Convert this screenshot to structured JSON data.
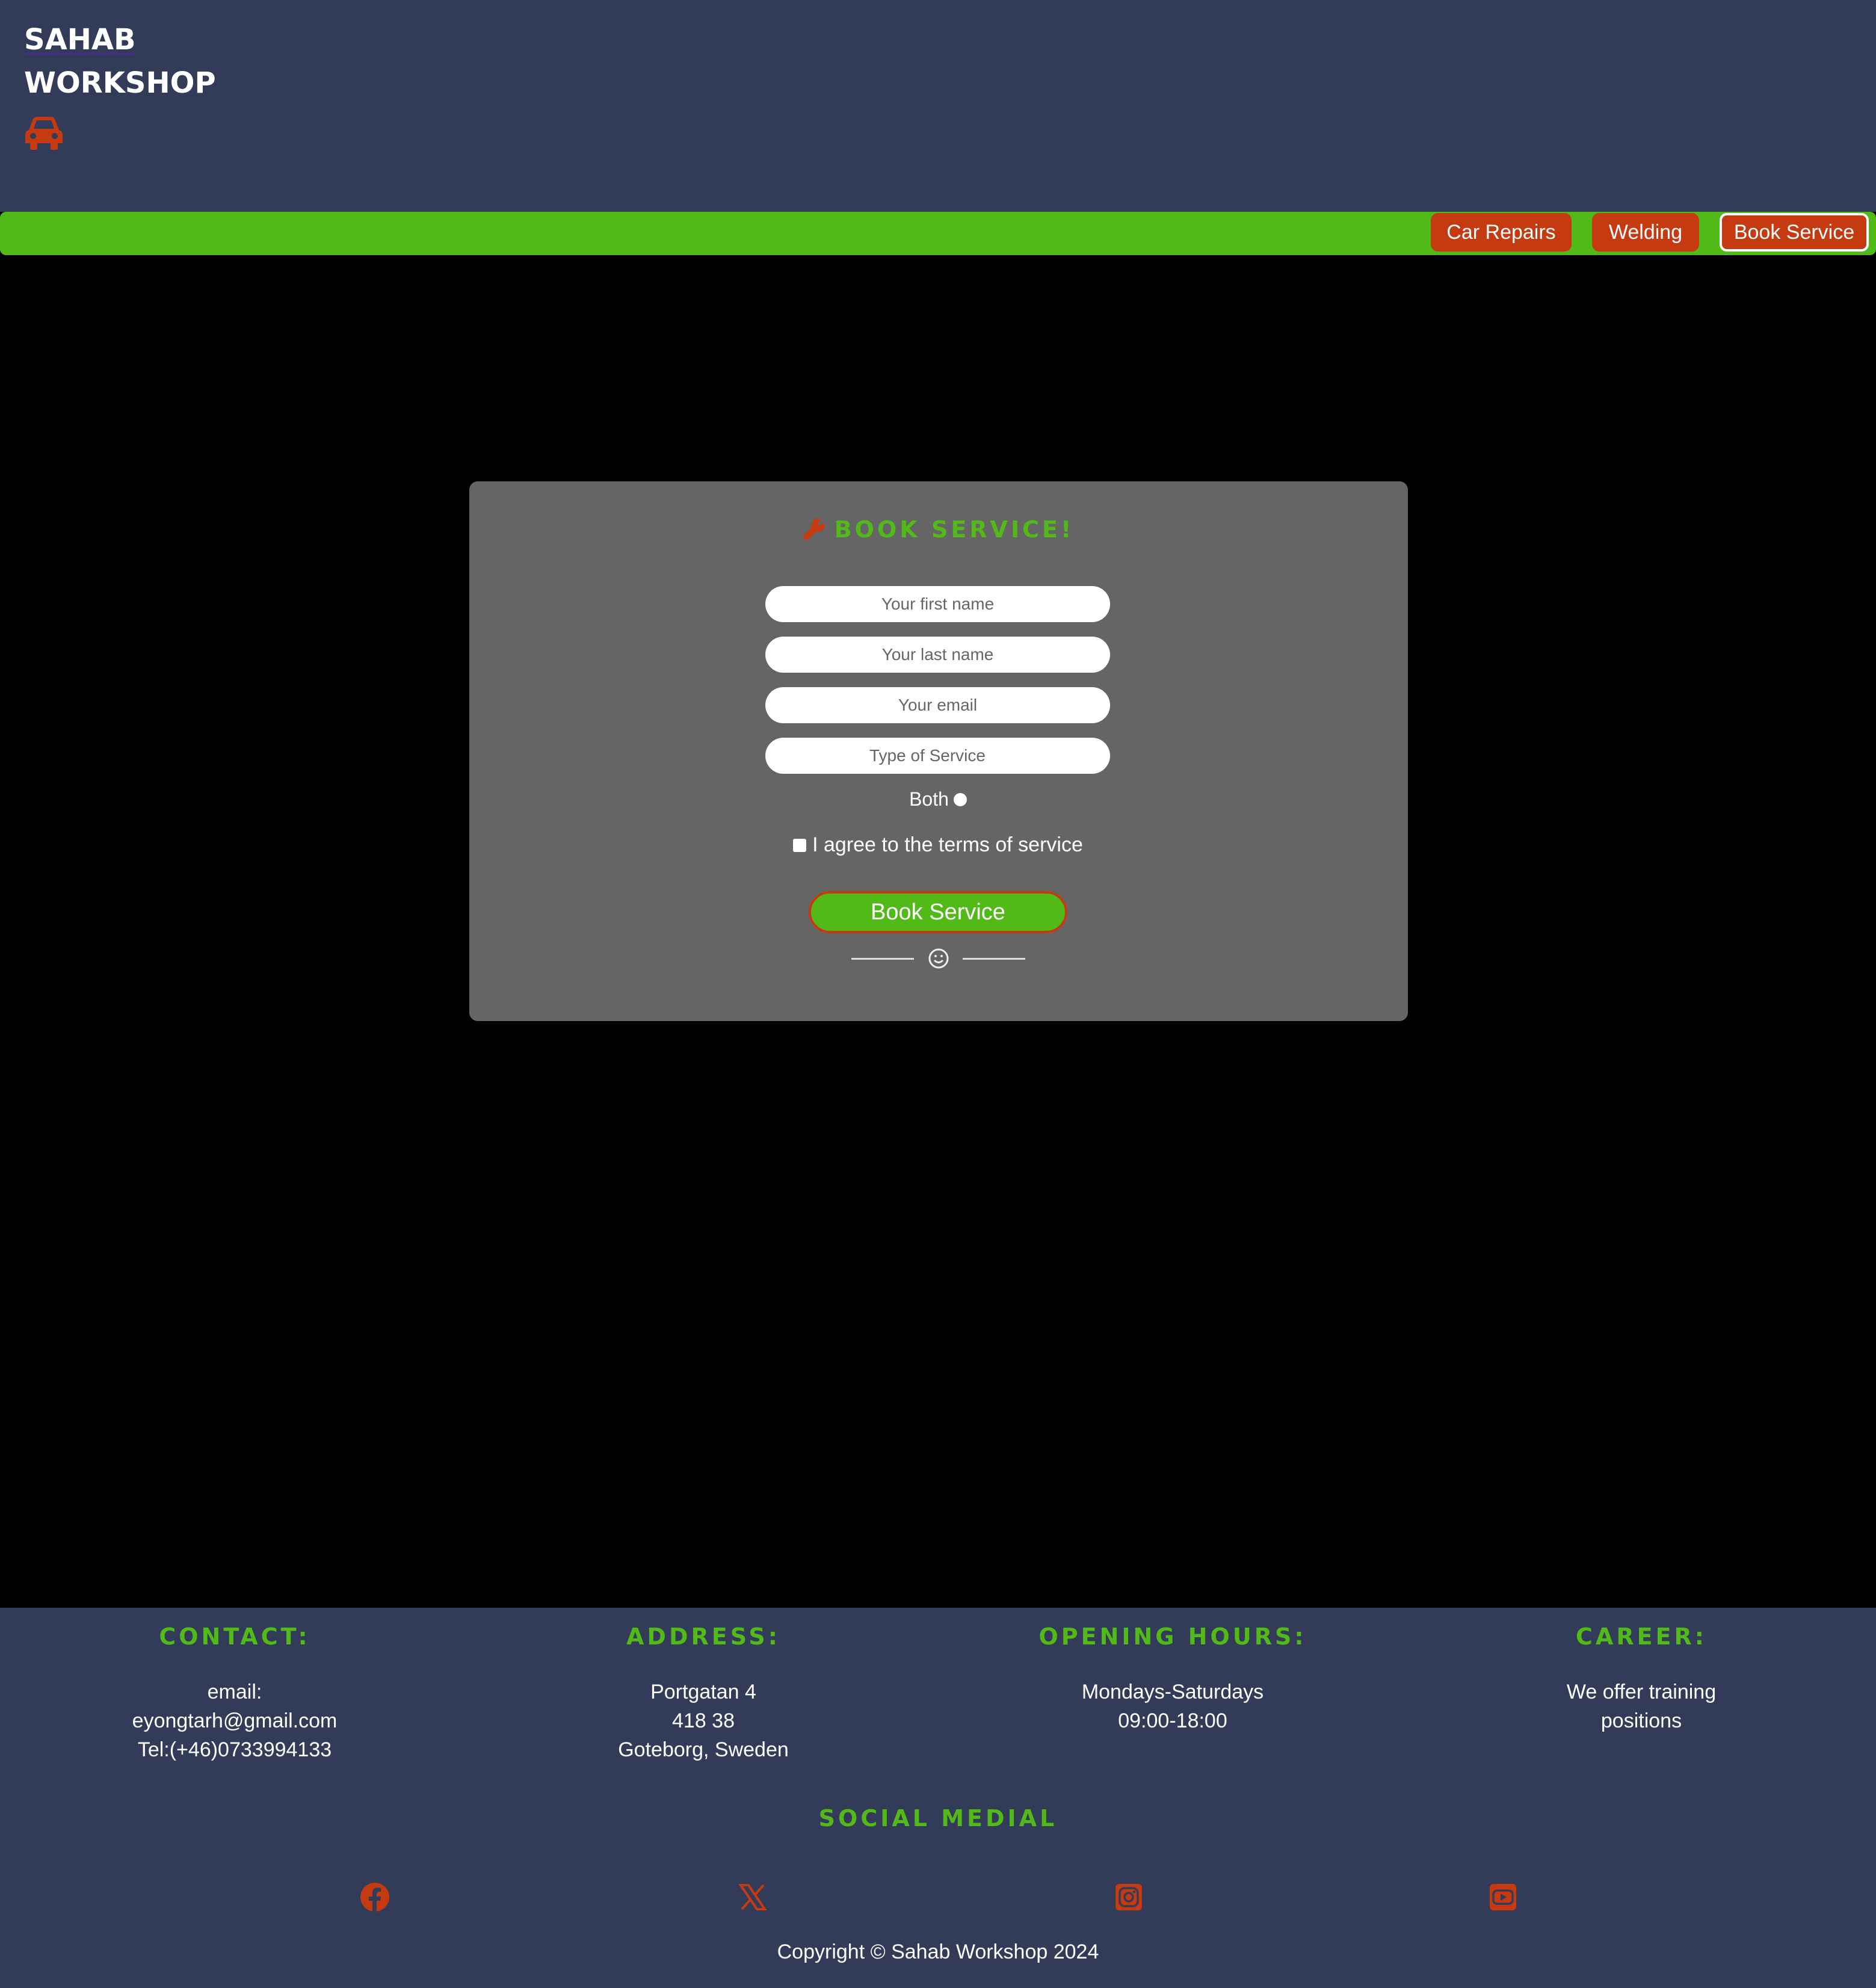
{
  "header": {
    "logo_line1": "SAHAB",
    "logo_line2": "WORKSHOP",
    "logo_icon": "car-icon"
  },
  "nav": {
    "items": [
      {
        "label": "Car Repairs"
      },
      {
        "label": "Welding"
      },
      {
        "label": "Book Service",
        "active": true
      }
    ]
  },
  "form": {
    "title": "BOOK SERVICE!",
    "title_icon": "wrench-icon",
    "first_name_placeholder": "Your first name",
    "last_name_placeholder": "Your last name",
    "email_placeholder": "Your email",
    "service_placeholder": "Type of Service",
    "radio_label": "Both",
    "terms_label": "I agree to the terms of service",
    "submit_label": "Book Service",
    "divider_icon": "smiley-icon"
  },
  "footer": {
    "columns": [
      {
        "title": "CONTACT:",
        "lines": [
          "email:",
          "eyongtarh@gmail.com",
          "Tel:(+46)0733994133"
        ]
      },
      {
        "title": "ADDRESS:",
        "lines": [
          "Portgatan 4",
          "418 38",
          "Goteborg, Sweden"
        ]
      },
      {
        "title": "OPENING HOURS:",
        "lines": [
          "Mondays-Saturdays",
          "09:00-18:00"
        ]
      },
      {
        "title": "CAREER:",
        "lines": [
          "We offer training",
          "positions"
        ]
      }
    ],
    "social_title": "SOCIAL MEDIAL",
    "social_icons": [
      "facebook-icon",
      "x-icon",
      "instagram-icon",
      "youtube-icon"
    ],
    "copyright": "Copyright © Sahab Workshop 2024"
  },
  "colors": {
    "header_bg": "#323b57",
    "accent_green": "#52ba18",
    "accent_red": "#c53a11",
    "card_bg": "#666566",
    "page_bg": "#000000"
  }
}
